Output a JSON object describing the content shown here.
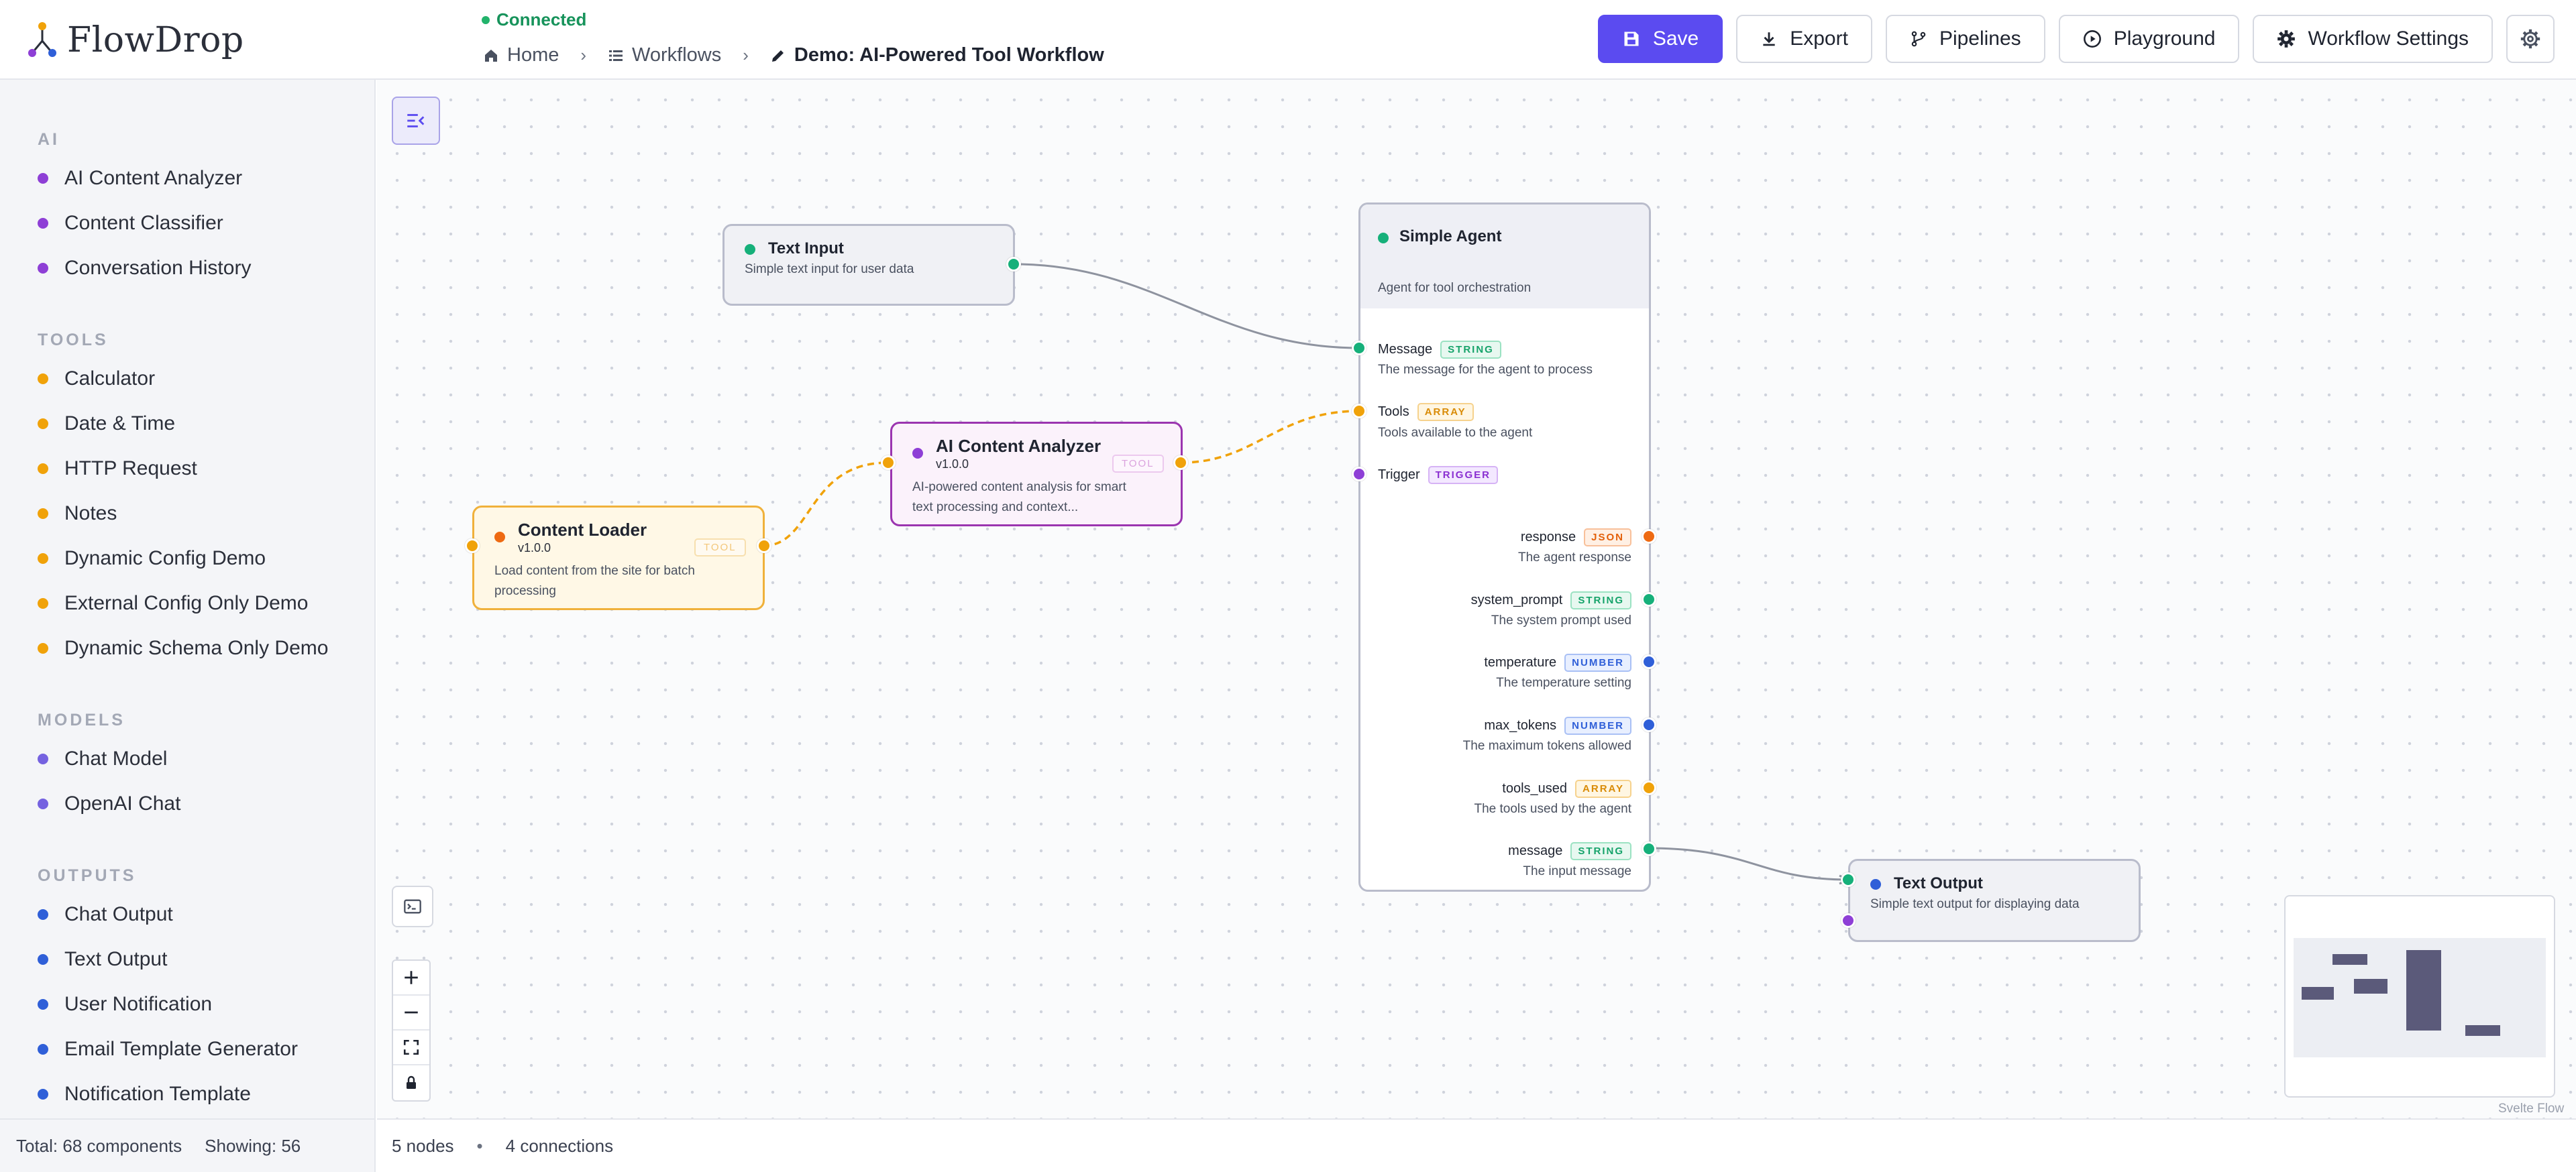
{
  "app": {
    "name": "FlowDrop"
  },
  "status": {
    "text": "Connected"
  },
  "breadcrumb": {
    "home": "Home",
    "workflows": "Workflows",
    "current": "Demo: AI-Powered Tool Workflow"
  },
  "toolbar": {
    "save": "Save",
    "export": "Export",
    "pipelines": "Pipelines",
    "playground": "Playground",
    "settings": "Workflow Settings"
  },
  "sidebar": {
    "categories": [
      {
        "title": "AI",
        "color": "#8e3fd6",
        "items": [
          "AI Content Analyzer",
          "Content Classifier",
          "Conversation History"
        ]
      },
      {
        "title": "TOOLS",
        "color": "#f0a20a",
        "items": [
          "Calculator",
          "Date & Time",
          "HTTP Request",
          "Notes",
          "Dynamic Config Demo",
          "External Config Only Demo",
          "Dynamic Schema Only Demo"
        ]
      },
      {
        "title": "MODELS",
        "color": "#7562e0",
        "items": [
          "Chat Model",
          "OpenAI Chat"
        ]
      },
      {
        "title": "OUTPUTS",
        "color": "#2f5fd8",
        "items": [
          "Chat Output",
          "Text Output",
          "User Notification",
          "Email Template Generator",
          "Notification Template"
        ]
      }
    ],
    "footer": {
      "total": "Total: 68 components",
      "showing": "Showing: 56"
    }
  },
  "canvas": {
    "footer": {
      "nodes": "5 nodes",
      "sep": "•",
      "connections": "4 connections"
    },
    "watermark": "Svelte Flow"
  },
  "nodes": {
    "text_input": {
      "title": "Text Input",
      "desc": "Simple text input for user data"
    },
    "content_loader": {
      "title": "Content Loader",
      "version": "v1.0.0",
      "badge": "TOOL",
      "desc1": "Load content from the site for batch",
      "desc2": "processing"
    },
    "ai_analyzer": {
      "title": "AI Content Analyzer",
      "version": "v1.0.0",
      "badge": "TOOL",
      "desc1": "AI-powered content analysis for smart",
      "desc2": "text processing and context..."
    },
    "simple_agent": {
      "title": "Simple Agent",
      "desc": "Agent for tool orchestration",
      "inputs": [
        {
          "name": "Message",
          "type": "STRING",
          "desc": "The message for the agent to process"
        },
        {
          "name": "Tools",
          "type": "ARRAY",
          "desc": "Tools available to the agent"
        },
        {
          "name": "Trigger",
          "type": "TRIGGER",
          "desc": ""
        }
      ],
      "outputs": [
        {
          "name": "response",
          "type": "JSON",
          "desc": "The agent response"
        },
        {
          "name": "system_prompt",
          "type": "STRING",
          "desc": "The system prompt used"
        },
        {
          "name": "temperature",
          "type": "NUMBER",
          "desc": "The temperature setting"
        },
        {
          "name": "max_tokens",
          "type": "NUMBER",
          "desc": "The maximum tokens allowed"
        },
        {
          "name": "tools_used",
          "type": "ARRAY",
          "desc": "The tools used by the agent"
        },
        {
          "name": "message",
          "type": "STRING",
          "desc": "The input message"
        }
      ]
    },
    "text_output": {
      "title": "Text Output",
      "desc": "Simple text output for displaying data"
    }
  },
  "colors": {
    "accent": "#5b4bf0",
    "string": "#16b07a",
    "array": "#f0a20a",
    "trigger": "#8e3fd6",
    "json": "#ee6a12",
    "number": "#2f5fd8"
  }
}
